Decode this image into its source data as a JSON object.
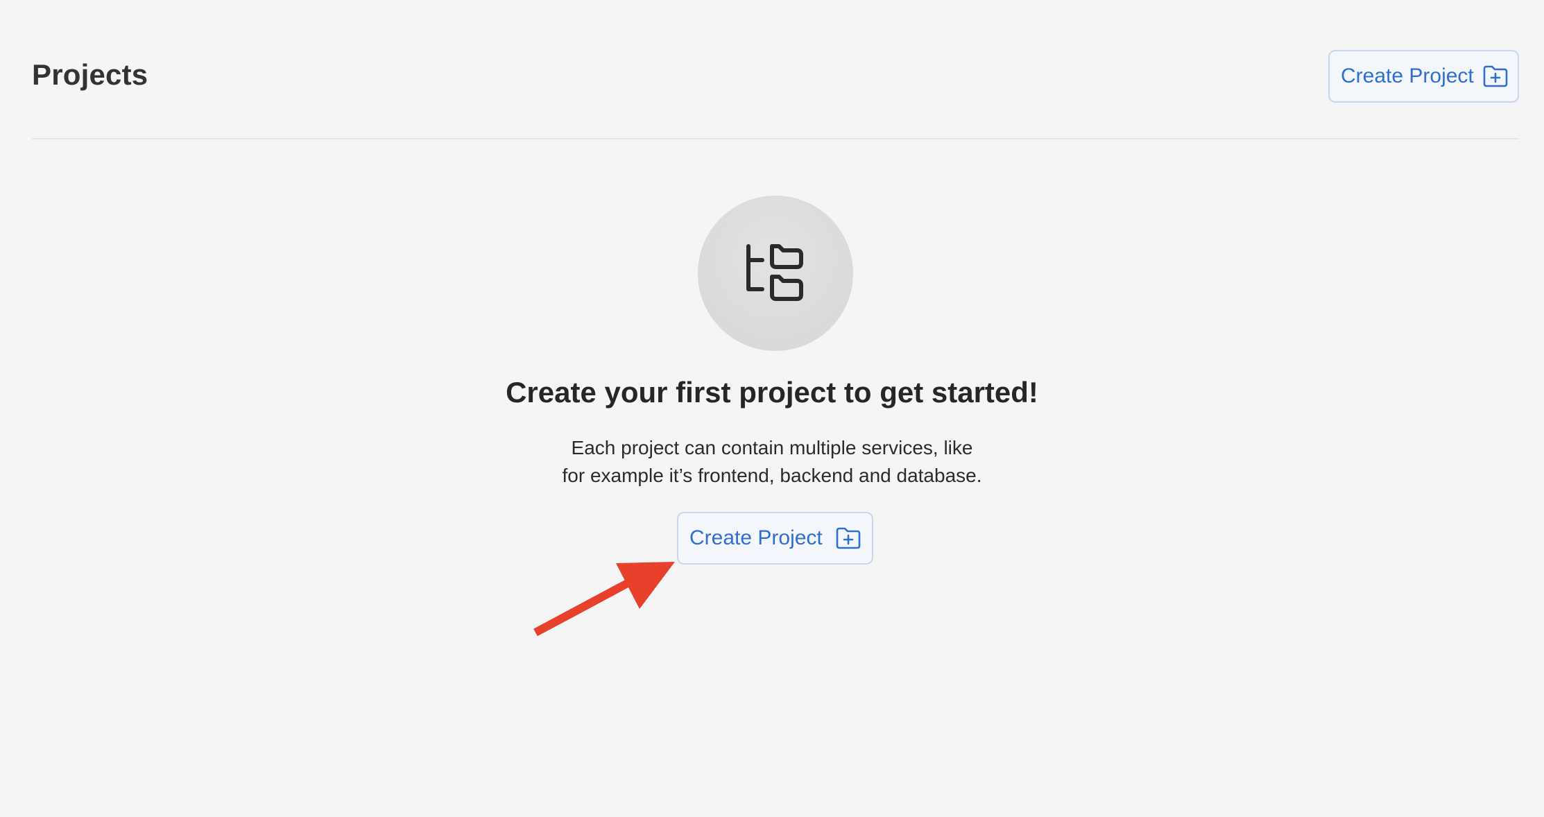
{
  "header": {
    "title": "Projects",
    "create_button_label": "Create Project"
  },
  "empty_state": {
    "icon": "folder-tree-icon",
    "title": "Create your first project to get started!",
    "description_line1": "Each project can contain multiple services, like",
    "description_line2": "for example it’s frontend, backend and database.",
    "create_button_label": "Create Project"
  },
  "annotation": {
    "arrow_color": "#e8412b"
  },
  "colors": {
    "accent": "#2f6fd0",
    "background": "#f5f5f5"
  }
}
